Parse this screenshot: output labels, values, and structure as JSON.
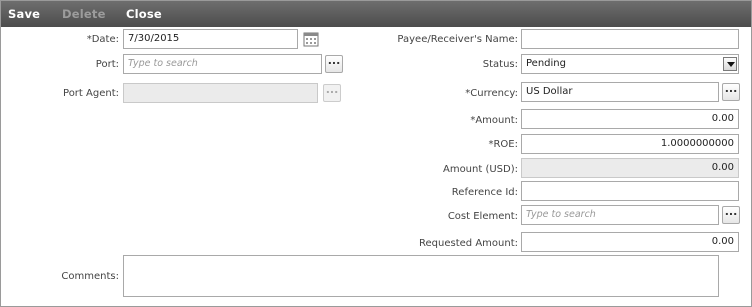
{
  "toolbar": {
    "save_label": "Save",
    "delete_label": "Delete",
    "close_label": "Close"
  },
  "left": {
    "date_label": "*Date:",
    "date_value": "7/30/2015",
    "port_label": "Port:",
    "port_placeholder": "Type to search",
    "port_agent_label": "Port Agent:",
    "comments_label": "Comments:"
  },
  "right": {
    "payee_label": "Payee/Receiver's Name:",
    "payee_value": "",
    "status_label": "Status:",
    "status_value": "Pending",
    "currency_label": "*Currency:",
    "currency_value": "US Dollar",
    "amount_label": "*Amount:",
    "amount_value": "0.00",
    "roe_label": "*ROE:",
    "roe_value": "1.0000000000",
    "amount_usd_label": "Amount (USD):",
    "amount_usd_value": "0.00",
    "reference_label": "Reference Id:",
    "reference_value": "",
    "cost_element_label": "Cost Element:",
    "cost_element_placeholder": "Type to search",
    "requested_label": "Requested Amount:",
    "requested_value": "0.00"
  },
  "icons": {
    "ellipsis": "...",
    "calendar": "calendar-icon",
    "dropdown": "chevron-down-icon"
  }
}
